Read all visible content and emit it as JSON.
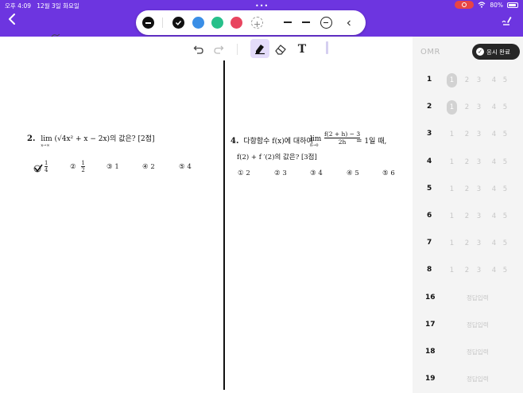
{
  "status_bar": {
    "time": "오후 4:09",
    "date": "12월 3일 화요일",
    "battery": "80%",
    "dots": "•••"
  },
  "nav": {
    "back_icon": "chevron-left-icon",
    "pen_icon": "pen-edit-icon"
  },
  "palette": {
    "colors": [
      "#111111",
      "#3a8ee6",
      "#27c08a",
      "#e8455f"
    ],
    "selected_color": "#111111"
  },
  "toolbar": {
    "text_tool": "T"
  },
  "questions": {
    "q2": {
      "number": "2.",
      "lim": "lim",
      "lim_sub": "x→∞",
      "expr": "(√4x² + x − 2x)의 값은? [2점]",
      "choices": [
        "① 1/4",
        "② 1/2",
        "③ 1",
        "④ 2",
        "⑤ 4"
      ],
      "c1_num": "1",
      "c1_den": "4",
      "c2_label": "②",
      "c2_num": "1",
      "c2_den": "2",
      "c3": "③  1",
      "c4": "④  2",
      "c5": "⑤  4"
    },
    "q4": {
      "number": "4.",
      "text": "다항함수 f(x)에 대하여",
      "lim": "lim",
      "lim_sub": "h→0",
      "frac_num": "f(2 + h) − 3",
      "frac_den": "2h",
      "after": "= 1일 때,",
      "line2": "f(2) + f ′(2)의 값은? [3점]",
      "c1": "①  2",
      "c2": "②  3",
      "c3": "③  4",
      "c4": "④  5",
      "c5": "⑤  6"
    }
  },
  "omr": {
    "title": "OMR",
    "finish_label": "응시 완료",
    "options": [
      "1",
      "2",
      "3",
      "4",
      "5"
    ],
    "rows": [
      {
        "num": "1",
        "selected": "1"
      },
      {
        "num": "2",
        "selected": "1"
      },
      {
        "num": "3",
        "selected": null
      },
      {
        "num": "4",
        "selected": null
      },
      {
        "num": "5",
        "selected": null
      },
      {
        "num": "6",
        "selected": null
      },
      {
        "num": "7",
        "selected": null
      },
      {
        "num": "8",
        "selected": null
      }
    ],
    "input_rows": [
      {
        "num": "16",
        "placeholder": "정답입력"
      },
      {
        "num": "17",
        "placeholder": "정답입력"
      },
      {
        "num": "18",
        "placeholder": "정답입력"
      },
      {
        "num": "19",
        "placeholder": "정답입력"
      }
    ]
  }
}
